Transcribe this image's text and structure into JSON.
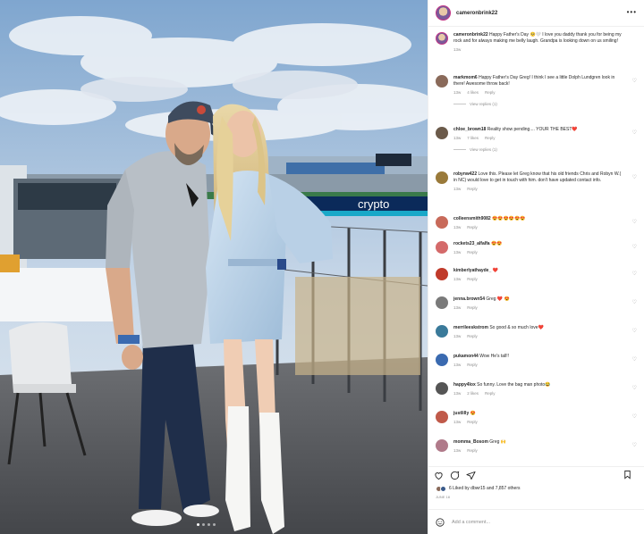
{
  "post": {
    "username": "cameronbrink22",
    "more_icon": "more-horizontal-icon"
  },
  "caption": {
    "username": "cameronbrink22",
    "text": "Happy Father's Day 🥺🤍 I love you daddy thank you for being my rock and for always making me belly laugh. Grandpa is looking down on us smiling!",
    "time": "13w"
  },
  "comments": [
    {
      "user": "markmom6",
      "text": "Happy Father's Day Greg! I think I see a little Dolph Lundgren look in there! Awesome throw back!",
      "time": "13w",
      "likes": "4 likes",
      "reply": "Reply",
      "view_replies": "View replies (1)",
      "avatar_color": "#8a6a5a"
    },
    {
      "user": "chloe_brown18",
      "text": "Reality show pending.... YOUR THE BEST❤️",
      "time": "13w",
      "likes": "7 likes",
      "reply": "Reply",
      "view_replies": "View replies (1)",
      "avatar_color": "#6b5a4a"
    },
    {
      "user": "robynw422",
      "text": "Love this. Please let Greg know that his old friends Chris and Robyn W.( in NC) would love to get in touch with him. don't have updated contact info.",
      "time": "13w",
      "likes": "",
      "reply": "Reply",
      "view_replies": "",
      "avatar_color": "#9a7a3a"
    },
    {
      "user": "colleensmith9082",
      "text": "😍😍😍😍😍😍",
      "time": "13w",
      "likes": "",
      "reply": "Reply",
      "view_replies": "",
      "avatar_color": "#c86a5a"
    },
    {
      "user": "rockets23_alfalfa",
      "text": "😍😍",
      "time": "13w",
      "likes": "",
      "reply": "Reply",
      "view_replies": "",
      "avatar_color": "#d46a6a"
    },
    {
      "user": "kimberlyathayde_",
      "text": "❤️",
      "time": "13w",
      "likes": "",
      "reply": "Reply",
      "view_replies": "",
      "avatar_color": "#c03a2a"
    },
    {
      "user": "jenna.brown54",
      "text": "Greg ❤️ 😍",
      "time": "13w",
      "likes": "",
      "reply": "Reply",
      "view_replies": "",
      "avatar_color": "#7a7a7a"
    },
    {
      "user": "merrileeskstrom",
      "text": "So good & so much love❤️",
      "time": "13w",
      "likes": "",
      "reply": "Reply",
      "view_replies": "",
      "avatar_color": "#3a7a9a"
    },
    {
      "user": "pukamon44",
      "text": "Wow He's tall!!",
      "time": "13w",
      "likes": "",
      "reply": "Reply",
      "view_replies": "",
      "avatar_color": "#3a6ab0"
    },
    {
      "user": "happy4lox",
      "text": "So funny. Love the bag man photo😂",
      "time": "13w",
      "likes": "2 likes",
      "reply": "Reply",
      "view_replies": "",
      "avatar_color": "#555555"
    },
    {
      "user": "justlilly",
      "text": "😍",
      "time": "13w",
      "likes": "",
      "reply": "Reply",
      "view_replies": "",
      "avatar_color": "#c05a4a"
    },
    {
      "user": "momma_Bosom",
      "text": "Greg 🙌",
      "time": "13w",
      "likes": "",
      "reply": "Reply",
      "view_replies": "",
      "avatar_color": "#b07a8a"
    }
  ],
  "footer": {
    "liked_by": "6 Liked by dbwr15 and 7,857 others",
    "date": "JUNE 18",
    "add_comment_placeholder": "Add a comment..."
  },
  "colors": {
    "accent_heart": "#e0245e",
    "muted": "#8e8e8e",
    "text": "#262626"
  },
  "icons": [
    "heart-icon",
    "comment-icon",
    "share-icon",
    "bookmark-icon",
    "emoji-icon",
    "more-horizontal-icon"
  ]
}
